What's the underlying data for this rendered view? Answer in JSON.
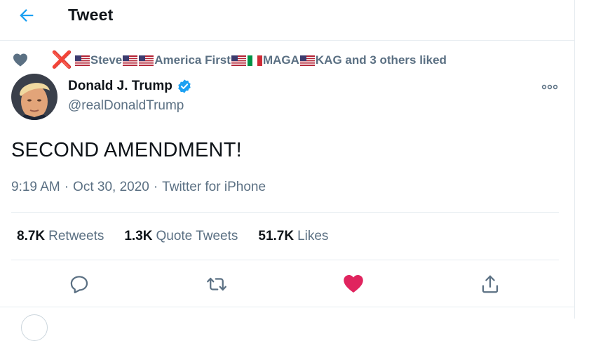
{
  "header": {
    "title": "Tweet",
    "back_icon": "arrow-left-icon"
  },
  "social_context": {
    "icon": "heart-icon",
    "x_mark": "❌",
    "segments": [
      {
        "type": "flag",
        "flag": "us"
      },
      {
        "type": "text",
        "text": "Steve"
      },
      {
        "type": "flag",
        "flag": "us"
      },
      {
        "type": "flag",
        "flag": "us"
      },
      {
        "type": "text",
        "text": "America First"
      },
      {
        "type": "flag",
        "flag": "us"
      },
      {
        "type": "flag",
        "flag": "it"
      },
      {
        "type": "text",
        "text": "MAGA"
      },
      {
        "type": "flag",
        "flag": "us"
      },
      {
        "type": "text",
        "text": "KAG and 3 others liked"
      }
    ]
  },
  "author": {
    "name": "Donald J. Trump",
    "handle": "@realDonaldTrump",
    "verified": true
  },
  "tweet": {
    "text": "SECOND AMENDMENT!",
    "time": "9:19 AM",
    "date": "Oct 30, 2020",
    "source": "Twitter for iPhone",
    "separator": "·"
  },
  "stats": [
    {
      "count": "8.7K",
      "label": "Retweets"
    },
    {
      "count": "1.3K",
      "label": "Quote Tweets"
    },
    {
      "count": "51.7K",
      "label": "Likes"
    }
  ],
  "actions": [
    "reply-icon",
    "retweet-icon",
    "like-icon-filled",
    "share-icon"
  ],
  "colors": {
    "accent": "#1da1f2",
    "like": "#e0245e",
    "secondary_text": "#5b7083",
    "border": "#e6ecf0"
  }
}
